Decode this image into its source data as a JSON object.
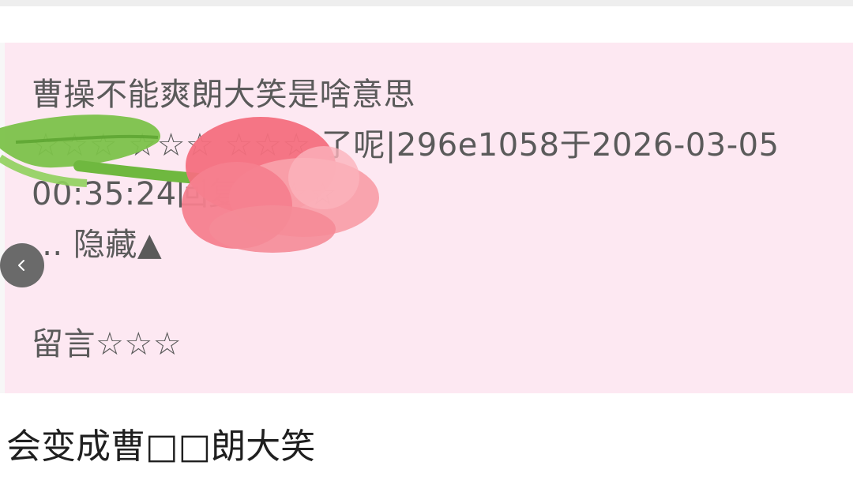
{
  "post": {
    "title": "曹操不能爽朗大笑是啥意思",
    "meta_line1": "☆☆☆ ☆☆☆ ☆☆☆ 了呢|296e1058于2026-03-05",
    "meta_line2": "00:35:24回复 ☆☆☆",
    "collapse_label": "... 隐藏▲",
    "comment_label": "留言☆☆☆"
  },
  "reply": {
    "text": "会变成曹□□朗大笑"
  },
  "icons": {
    "back": "chevron-left-icon",
    "sticker": "tulip-sticker-icon"
  },
  "colors": {
    "card_bg": "#fde8f2",
    "text": "#5a5a5a",
    "reply_text": "#1f1f1f"
  }
}
